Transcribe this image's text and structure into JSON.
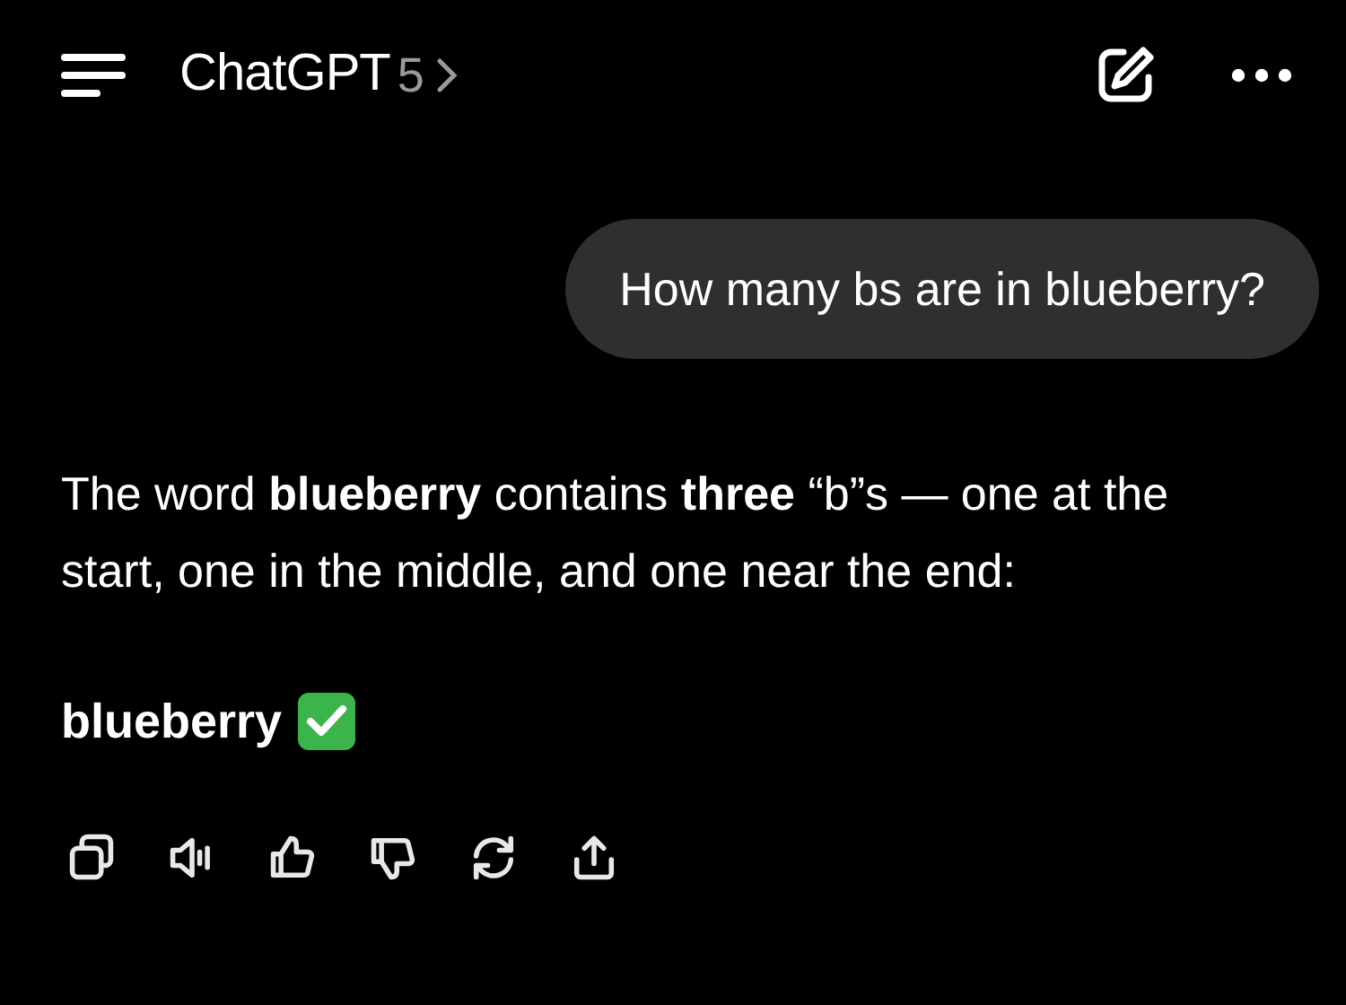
{
  "header": {
    "title": "ChatGPT",
    "model": "5"
  },
  "user_message": "How many bs are in blueberry?",
  "assistant": {
    "paragraph": "The word **blueberry** contains **three** “b”s — one at the start, one in the middle, and one near the end:",
    "answer": "blueberry"
  },
  "actions": [
    {
      "kind": "copy"
    },
    {
      "kind": "speaker"
    },
    {
      "kind": "thumbs-up"
    },
    {
      "kind": "thumbs-down"
    },
    {
      "kind": "regenerate"
    },
    {
      "kind": "share"
    }
  ]
}
